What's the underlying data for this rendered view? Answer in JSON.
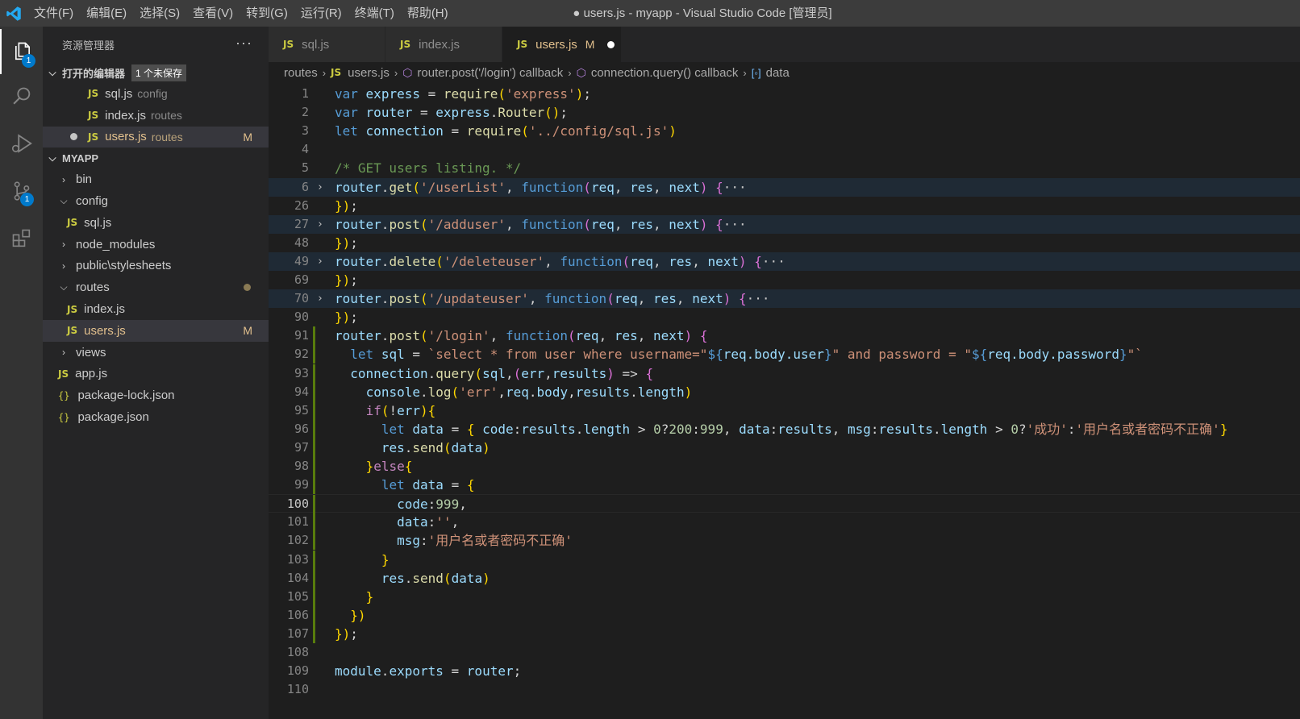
{
  "window": {
    "title": "● users.js - myapp - Visual Studio Code [管理员]",
    "menu": [
      "文件(F)",
      "编辑(E)",
      "选择(S)",
      "查看(V)",
      "转到(G)",
      "运行(R)",
      "终端(T)",
      "帮助(H)"
    ]
  },
  "activity_bar": {
    "explorer_badge": "1",
    "scm_badge": "1",
    "items": [
      "explorer",
      "search",
      "run-debug",
      "source-control",
      "extensions"
    ]
  },
  "sidebar": {
    "title": "资源管理器",
    "more": "···",
    "open_editors": {
      "label": "打开的编辑器",
      "unsaved_badge": "1 个未保存",
      "items": [
        {
          "name": "sql.js",
          "desc": "config",
          "status": ""
        },
        {
          "name": "index.js",
          "desc": "routes",
          "status": ""
        },
        {
          "name": "users.js",
          "desc": "routes",
          "status": "M"
        }
      ]
    },
    "project": {
      "label": "MYAPP",
      "items": [
        {
          "name": "bin",
          "kind": "folder",
          "expanded": false
        },
        {
          "name": "config",
          "kind": "folder",
          "expanded": true
        },
        {
          "name": "sql.js",
          "kind": "js"
        },
        {
          "name": "node_modules",
          "kind": "folder",
          "expanded": false
        },
        {
          "name": "public\\stylesheets",
          "kind": "folder",
          "expanded": false
        },
        {
          "name": "routes",
          "kind": "folder",
          "expanded": true
        },
        {
          "name": "index.js",
          "kind": "js"
        },
        {
          "name": "users.js",
          "kind": "js",
          "status": "M"
        },
        {
          "name": "views",
          "kind": "folder",
          "expanded": false
        },
        {
          "name": "app.js",
          "kind": "js"
        },
        {
          "name": "package-lock.json",
          "kind": "json"
        },
        {
          "name": "package.json",
          "kind": "json"
        }
      ]
    }
  },
  "tabs": [
    {
      "label": "sql.js",
      "active": false
    },
    {
      "label": "index.js",
      "active": false
    },
    {
      "label": "users.js",
      "active": true,
      "status": "M"
    }
  ],
  "breadcrumb": [
    "routes",
    "users.js",
    "router.post('/login') callback",
    "connection.query() callback",
    "data"
  ],
  "editor": {
    "current_line": "100",
    "lines": [
      {
        "n": "1",
        "text": "var express = require('express');"
      },
      {
        "n": "2",
        "text": "var router = express.Router();"
      },
      {
        "n": "3",
        "text": "let connection = require('../config/sql.js')"
      },
      {
        "n": "4",
        "text": ""
      },
      {
        "n": "5",
        "text": "/* GET users listing. */"
      },
      {
        "n": "6",
        "text": "router.get('/userList', function(req, res, next) {···"
      },
      {
        "n": "26",
        "text": "});"
      },
      {
        "n": "27",
        "text": "router.post('/adduser', function(req, res, next) {···"
      },
      {
        "n": "48",
        "text": "});"
      },
      {
        "n": "49",
        "text": "router.delete('/deleteuser', function(req, res, next) {···"
      },
      {
        "n": "69",
        "text": "});"
      },
      {
        "n": "70",
        "text": "router.post('/updateuser', function(req, res, next) {···"
      },
      {
        "n": "90",
        "text": "});"
      },
      {
        "n": "91",
        "text": "router.post('/login', function(req, res, next) {"
      },
      {
        "n": "92",
        "text": "  let sql = `select * from user where username=\"${req.body.user}\" and password = \"${req.body.password}\"`"
      },
      {
        "n": "93",
        "text": "  connection.query(sql,(err,results) => {"
      },
      {
        "n": "94",
        "text": "    console.log('err',req.body,results.length)"
      },
      {
        "n": "95",
        "text": "    if(!err){"
      },
      {
        "n": "96",
        "text": "      let data = { code:results.length > 0?200:999, data:results, msg:results.length > 0?'成功':'用户名或者密码不正确'}"
      },
      {
        "n": "97",
        "text": "      res.send(data)"
      },
      {
        "n": "98",
        "text": "    }else{"
      },
      {
        "n": "99",
        "text": "      let data = {"
      },
      {
        "n": "100",
        "text": "        code:999,"
      },
      {
        "n": "101",
        "text": "        data:'',"
      },
      {
        "n": "102",
        "text": "        msg:'用户名或者密码不正确'"
      },
      {
        "n": "103",
        "text": "      }"
      },
      {
        "n": "104",
        "text": "      res.send(data)"
      },
      {
        "n": "105",
        "text": "    }"
      },
      {
        "n": "106",
        "text": "  })"
      },
      {
        "n": "107",
        "text": "});"
      },
      {
        "n": "108",
        "text": ""
      },
      {
        "n": "109",
        "text": "module.exports = router;"
      },
      {
        "n": "110",
        "text": ""
      }
    ]
  },
  "colors": {
    "accent": "#007acc",
    "modified": "#e2c08d",
    "js_icon": "#cbcb41",
    "added_gutter": "#587c0c"
  }
}
